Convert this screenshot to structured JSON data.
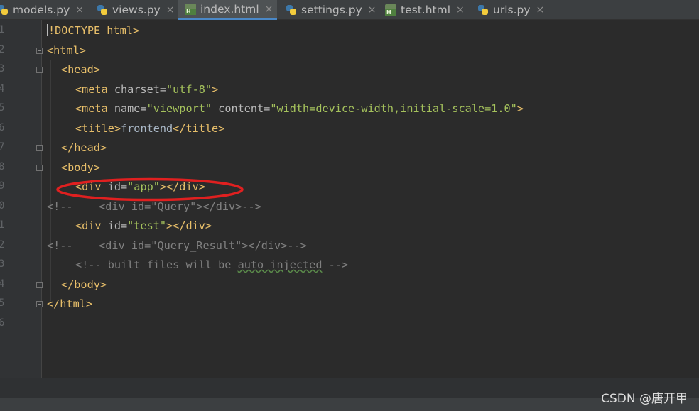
{
  "tabs": [
    {
      "label": "models.py",
      "type": "python",
      "active": false
    },
    {
      "label": "views.py",
      "type": "python",
      "active": false
    },
    {
      "label": "index.html",
      "type": "html",
      "active": true
    },
    {
      "label": "settings.py",
      "type": "python",
      "active": false
    },
    {
      "label": "test.html",
      "type": "html",
      "active": false
    },
    {
      "label": "urls.py",
      "type": "python",
      "active": false
    }
  ],
  "close_glyph": "×",
  "html_icon_letter": "H",
  "line_numbers": [
    "1",
    "2",
    "3",
    "4",
    "5",
    "6",
    "7",
    "8",
    "9",
    "0",
    "1",
    "2",
    "3",
    "4",
    "5",
    "6"
  ],
  "code": {
    "l1_a": "!DOCTYPE html>",
    "l2": "<html>",
    "l3": "<head>",
    "l4_tag": "<meta",
    "l4_attr": " charset=",
    "l4_val": "\"utf-8\"",
    "l4_end": ">",
    "l5_tag": "<meta",
    "l5_attr1": " name=",
    "l5_val1": "\"viewport\"",
    "l5_attr2": " content=",
    "l5_val2": "\"width=device-width,initial-scale=1.0\"",
    "l5_end": ">",
    "l6_open": "<title>",
    "l6_text": "frontend",
    "l6_close": "</title>",
    "l7": "</head>",
    "l8": "<body>",
    "l9_tag": "<div",
    "l9_attr": " id=",
    "l9_val": "\"app\"",
    "l9_end": "></div>",
    "l10": "<!--    <div id=\"Query\"></div>-->",
    "l11_tag": "<div",
    "l11_attr": " id=",
    "l11_val": "\"test\"",
    "l11_end": "></div>",
    "l12": "<!--    <div id=\"Query_Result\"></div>-->",
    "l13_a": "<!-- built files will be ",
    "l13_u": "auto injected",
    "l13_b": " -->",
    "l14": "</body>",
    "l15": "</html>"
  },
  "watermark": "CSDN @唐开甲",
  "colors": {
    "editor_bg": "#2b2b2b",
    "tag": "#e8bf6a",
    "attribute_value": "#a5c25c",
    "comment": "#808080",
    "annotation_ellipse": "#e02020",
    "active_tab_underline": "#4a88c7"
  }
}
